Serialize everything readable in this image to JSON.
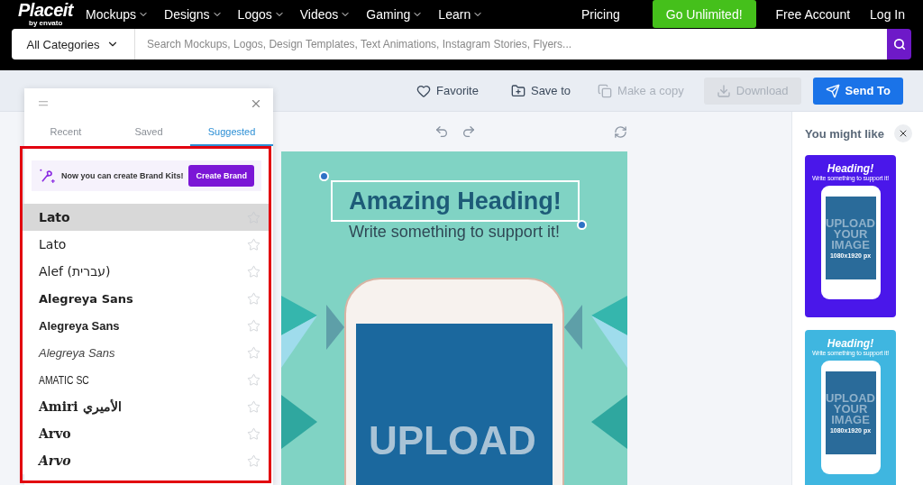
{
  "header": {
    "logo": "Placeit",
    "logo_sub": "by envato",
    "nav": [
      {
        "label": "Mockups"
      },
      {
        "label": "Designs"
      },
      {
        "label": "Logos"
      },
      {
        "label": "Videos"
      },
      {
        "label": "Gaming"
      },
      {
        "label": "Learn"
      }
    ],
    "pricing": "Pricing",
    "cta": "Go Unlimited!",
    "account": "Free Account",
    "login": "Log In"
  },
  "search": {
    "category": "All Categories",
    "placeholder": "Search Mockups, Logos, Design Templates, Text Animations, Instagram Stories, Flyers..."
  },
  "toolbar": {
    "actions": [
      {
        "label": "Favorite",
        "kind": "favorite",
        "disabled": false
      },
      {
        "label": "Save to",
        "kind": "save",
        "disabled": false
      },
      {
        "label": "Make a copy",
        "kind": "copy",
        "disabled": true
      },
      {
        "label": "Download",
        "kind": "download",
        "disabled": true
      },
      {
        "label": "Send To",
        "kind": "send",
        "disabled": false
      }
    ]
  },
  "font_panel": {
    "tabs": [
      {
        "label": "Recent",
        "selected": false
      },
      {
        "label": "Saved",
        "selected": false
      },
      {
        "label": "Suggested",
        "selected": true
      }
    ],
    "banner": {
      "text": "Now you can create Brand Kits!",
      "button": "Create Brand"
    },
    "fonts": [
      {
        "name": "Lato",
        "kind": "bold",
        "selected": true,
        "starred": false
      },
      {
        "name": "Lato",
        "kind": "regular",
        "selected": false,
        "starred": false
      },
      {
        "name": "Alef (עברית)",
        "kind": "regular",
        "selected": false,
        "starred": false
      },
      {
        "name": "Alegreya Sans",
        "kind": "black",
        "selected": false,
        "starred": false
      },
      {
        "name": "Alegreya Sans",
        "kind": "semibold",
        "selected": false,
        "starred": false
      },
      {
        "name": "Alegreya Sans",
        "kind": "italic",
        "selected": false,
        "starred": false
      },
      {
        "name": "AMATIC SC",
        "kind": "condensed",
        "selected": false,
        "starred": false
      },
      {
        "name": "Amiri الأميري",
        "kind": "serif",
        "selected": false,
        "starred": false
      },
      {
        "name": "Arvo",
        "kind": "serif",
        "selected": false,
        "starred": false
      },
      {
        "name": "Arvo",
        "kind": "slanted",
        "selected": false,
        "starred": false
      }
    ]
  },
  "canvas": {
    "heading": "Amazing Heading!",
    "subheading": "Write something to support it!",
    "screen_text": "UPLOAD"
  },
  "suggestions": {
    "title": "You might like",
    "templates": [
      {
        "heading": "Heading!",
        "subheading": "Write something to support it!",
        "screen_lines": [
          "UPLOAD",
          "YOUR",
          "IMAGE"
        ],
        "size": "1080x1920 px",
        "color": "#4a17ea"
      },
      {
        "heading": "Heading!",
        "subheading": "Write something to support it!",
        "screen_lines": [
          "UPLOAD",
          "YOUR",
          "IMAGE"
        ],
        "size": "1080x1920 px",
        "color": "#3fb6e0"
      }
    ]
  }
}
